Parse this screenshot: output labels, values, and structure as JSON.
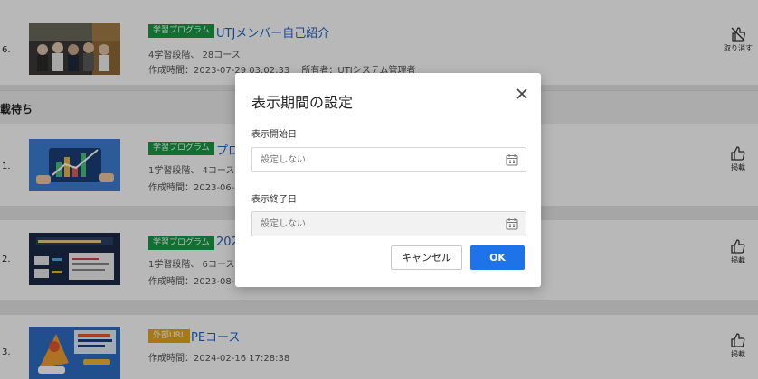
{
  "section": {
    "label": "載待ち"
  },
  "rows": [
    {
      "num": "6.",
      "tag": "学習プログラム",
      "title": "UTJメンバー自己紹介",
      "meta1": "4学習段階、 28コース",
      "meta2": "作成時間：2023-07-29 03:02:33　 所有者：UTJシステム管理者",
      "action": "取り消す"
    },
    {
      "num": "1.",
      "tag": "学習プログラム",
      "title": "プロ",
      "meta1": "1学習段階、 4コース",
      "meta2": "作成時間：2023-06-",
      "action": "掲載"
    },
    {
      "num": "2.",
      "tag": "学習プログラム",
      "title": "202",
      "meta1": "1学習段階、 6コース",
      "meta2": "作成時間：2023-08-",
      "action": "掲載"
    },
    {
      "num": "3.",
      "tag": "外部URL",
      "title": "PEコース",
      "meta1": "作成時間：2024-02-16 17:28:38",
      "action": "掲載"
    }
  ],
  "dialog": {
    "title": "表示期間の設定",
    "start_label": "表示開始日",
    "start_placeholder": "設定しない",
    "end_label": "表示終了日",
    "end_placeholder": "設定しない",
    "cancel": "キャンセル",
    "ok": "OK"
  },
  "colors": {
    "tag_green": "#1a9a46",
    "tag_orange": "#e8a81c",
    "link_blue": "#1f65c8",
    "primary_button": "#1f73e8"
  },
  "icons": {
    "close": "close-icon",
    "calendar": "calendar-icon",
    "thumbs_up": "thumbs-up-icon",
    "unpublish": "unpublish-icon"
  }
}
